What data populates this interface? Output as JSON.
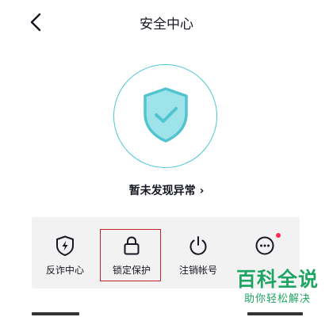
{
  "nav": {
    "title": "安全中心",
    "back_icon": "chevron-left-icon"
  },
  "hero": {
    "icon": "shield-check-icon",
    "status_text": "暂未发现异常",
    "chevron": "›"
  },
  "features": [
    {
      "label": "反诈中心",
      "icon": "shield-lightning-icon"
    },
    {
      "label": "锁定保护",
      "icon": "lock-icon"
    },
    {
      "label": "注销帐号",
      "icon": "power-icon"
    },
    {
      "label": "",
      "icon": "more-icon",
      "has_badge": true
    }
  ],
  "watermark": {
    "main": "百科全说",
    "sub": "助你轻松解决"
  },
  "colors": {
    "accent": "#4fc6d3",
    "shield_fill": "#9ee3ea",
    "highlight": "#c8202a",
    "badge": "#fe2c55",
    "panel_bg": "#f2f2f3"
  }
}
